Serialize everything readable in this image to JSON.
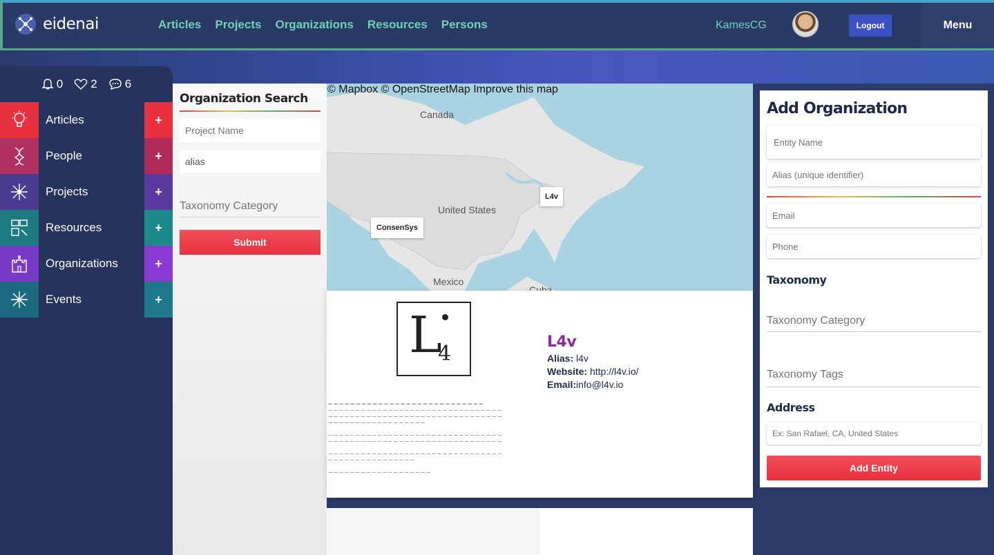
{
  "app": {
    "name": "eidenai",
    "nav": [
      "Articles",
      "Projects",
      "Organizations",
      "Resources",
      "Persons"
    ],
    "username": "KamesCG",
    "logout_label": "Logout",
    "menu_label": "Menu"
  },
  "sidebar": {
    "notifications": {
      "alerts": "0",
      "likes": "2",
      "messages": "6"
    },
    "items": [
      {
        "label": "Articles",
        "icon": "lightbulb-icon",
        "color": "#e8303e"
      },
      {
        "label": "People",
        "icon": "dna-icon",
        "color": "#c0306a"
      },
      {
        "label": "Projects",
        "icon": "network-icon",
        "color": "#5a3aa0"
      },
      {
        "label": "Resources",
        "icon": "tools-icon",
        "color": "#1c8a8a"
      },
      {
        "label": "Organizations",
        "icon": "castle-icon",
        "color": "#8a3ad0"
      },
      {
        "label": "Events",
        "icon": "network-icon",
        "color": "#1c8a8a"
      }
    ],
    "add_label": "+"
  },
  "search": {
    "title": "Organization Search",
    "project_placeholder": "Project Name",
    "alias_value": "alias",
    "taxonomy_placeholder": "Taxonomy Category",
    "submit_label": "Submit"
  },
  "map": {
    "attribution": "© Mapbox © OpenStreetMap Improve this map",
    "labels": [
      "Canada",
      "United States",
      "Mexico",
      "Cuba"
    ],
    "markers": [
      "L4v",
      "ConsenSys"
    ]
  },
  "result": {
    "name": "L4v",
    "alias_label": "Alias:",
    "alias": "l4v",
    "website_label": "Website:",
    "website": "http://l4v.io/",
    "email_label": "Email:",
    "email": "info@l4v.io",
    "logo_letter": "L",
    "logo_sub": "4"
  },
  "add_org": {
    "title": "Add Organization",
    "entity_name_placeholder": "Entity Name",
    "alias_placeholder": "Alias (unique identifier)",
    "email_placeholder": "Email",
    "phone_placeholder": "Phone",
    "taxonomy_label": "Taxonomy",
    "taxonomy_category_placeholder": "Taxonomy Category",
    "taxonomy_tags_placeholder": "Taxonomy Tags",
    "address_label": "Address",
    "address_placeholder": "Ex: San Rafael, CA, United States",
    "submit_label": "Add Entity"
  }
}
